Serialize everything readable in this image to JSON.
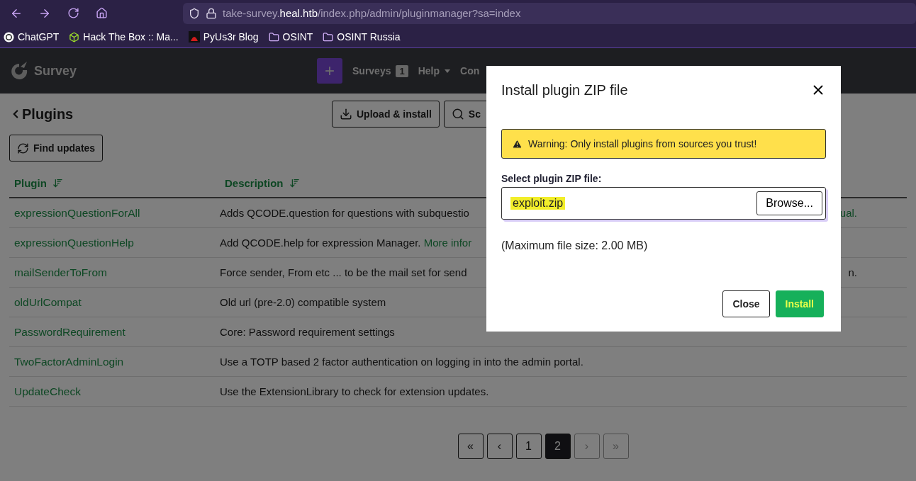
{
  "browser": {
    "url_prefix": "take-survey.",
    "url_domain": "heal.htb",
    "url_path": "/index.php/admin/pluginmanager?sa=index",
    "bookmarks": [
      {
        "label": "ChatGPT",
        "kind": "chatgpt"
      },
      {
        "label": "Hack The Box :: Ma...",
        "kind": "cube"
      },
      {
        "label": "PyUs3r Blog",
        "kind": "avatar"
      },
      {
        "label": "OSINT",
        "kind": "folder"
      },
      {
        "label": "OSINT Russia",
        "kind": "folder"
      }
    ]
  },
  "navbar": {
    "logo_text": "Survey",
    "add_button": "+",
    "menu": [
      {
        "label": "Surveys",
        "badge": "1",
        "dropdown": false
      },
      {
        "label": "Help",
        "dropdown": true
      },
      {
        "label": "Con",
        "dropdown": false
      }
    ]
  },
  "page": {
    "title": "Plugins",
    "actions": [
      "Upload & install",
      "Sc"
    ],
    "find_updates": "Find updates"
  },
  "table": {
    "columns": [
      "Plugin",
      "Description"
    ],
    "rows": [
      {
        "plugin": "expressionQuestionForAll",
        "description": "Adds QCODE.question for questions with subquestio",
        "tail_link": "ual."
      },
      {
        "plugin": "expressionQuestionHelp",
        "description": "Add QCODE.help for expression Manager.",
        "link": "More infor"
      },
      {
        "plugin": "mailSenderToFrom",
        "description": "Force sender, From etc ... to be the mail set for send",
        "tail": "n."
      },
      {
        "plugin": "oldUrlCompat",
        "description": "Old url (pre-2.0) compatible system"
      },
      {
        "plugin": "PasswordRequirement",
        "description": "Core: Password requirement settings"
      },
      {
        "plugin": "TwoFactorAdminLogin",
        "description": "Use a TOTP based 2 factor authentication on logging in into the admin portal."
      },
      {
        "plugin": "UpdateCheck",
        "description": "Use the ExtensionLibrary to check for extension updates."
      }
    ]
  },
  "pagination": [
    {
      "label": "«",
      "selected": false,
      "disabled": false
    },
    {
      "label": "‹",
      "selected": false,
      "disabled": false
    },
    {
      "label": "1",
      "selected": false,
      "disabled": false
    },
    {
      "label": "2",
      "selected": true,
      "disabled": false
    },
    {
      "label": "›",
      "selected": false,
      "disabled": true
    },
    {
      "label": "»",
      "selected": false,
      "disabled": true
    }
  ],
  "modal": {
    "title": "Install plugin ZIP file",
    "warning": "Warning: Only install plugins from sources you trust!",
    "field_label": "Select plugin ZIP file:",
    "file_value": "exploit.zip",
    "browse": "Browse...",
    "note": "(Maximum file size: 2.00 MB)",
    "buttons": [
      {
        "label": "Close",
        "kind": "secondary"
      },
      {
        "label": "Install",
        "kind": "primary"
      }
    ]
  }
}
